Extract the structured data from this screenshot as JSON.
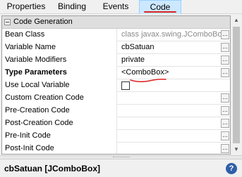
{
  "tabs": [
    {
      "label": "Properties",
      "active": false
    },
    {
      "label": "Binding",
      "active": false
    },
    {
      "label": "Events",
      "active": false
    },
    {
      "label": "Code",
      "active": true
    }
  ],
  "section": {
    "title": "Code Generation"
  },
  "rows": [
    {
      "name": "Bean Class",
      "value": "class javax.swing.JComboBox",
      "dim": true,
      "editor": "dots"
    },
    {
      "name": "Variable Name",
      "value": "cbSatuan",
      "editor": "dots"
    },
    {
      "name": "Variable Modifiers",
      "value": "private",
      "editor": "dots"
    },
    {
      "name": "Type Parameters",
      "value": "<ComboBox>",
      "bold": true,
      "editor": "dots"
    },
    {
      "name": "Use Local Variable",
      "value": "",
      "editor": "checkbox",
      "checked": false
    },
    {
      "name": "Custom Creation Code",
      "value": "",
      "editor": "dots"
    },
    {
      "name": "Pre-Creation Code",
      "value": "",
      "editor": "dots"
    },
    {
      "name": "Post-Creation Code",
      "value": "",
      "editor": "dots"
    },
    {
      "name": "Pre-Init Code",
      "value": "",
      "editor": "dots"
    },
    {
      "name": "Post-Init Code",
      "value": "",
      "editor": "dots"
    }
  ],
  "dots_label": "...",
  "status": {
    "label": "cbSatuan [JComboBox]"
  },
  "help_glyph": "?",
  "colors": {
    "accent": "#cce8ff",
    "annotation": "#dd2222",
    "help": "#2f5fa8"
  }
}
